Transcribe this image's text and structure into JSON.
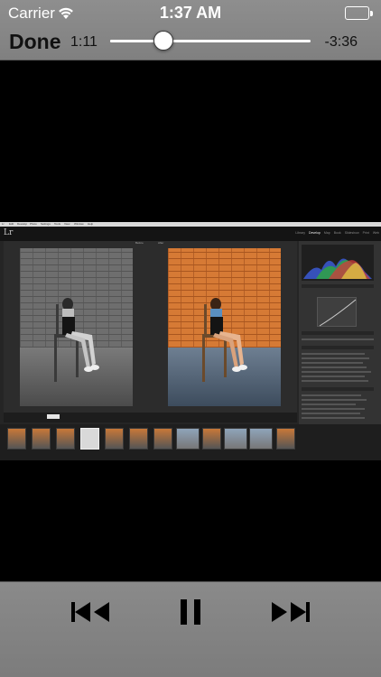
{
  "status_bar": {
    "carrier": "Carrier",
    "time": "1:37 AM"
  },
  "player": {
    "done_label": "Done",
    "elapsed": "1:11",
    "remaining": "-3:36",
    "progress": 0.265
  },
  "lightroom": {
    "menu": [
      "Lr",
      "Edit",
      "Develop",
      "Photo",
      "Settings",
      "Tools",
      "View",
      "Window",
      "Help"
    ],
    "logo": "Lr",
    "modules": [
      "Library",
      "Develop",
      "Map",
      "Book",
      "Slideshow",
      "Print",
      "Web"
    ],
    "active_module": "Develop",
    "before_label": "Before",
    "after_label": "After"
  },
  "colors": {
    "bar_background": "#858585",
    "text_dark": "#111111",
    "status_text": "#ffffff"
  },
  "icons": {
    "wifi": "wifi-icon",
    "battery": "battery-icon",
    "previous": "previous-track-icon",
    "pause": "pause-icon",
    "next": "next-track-icon"
  }
}
